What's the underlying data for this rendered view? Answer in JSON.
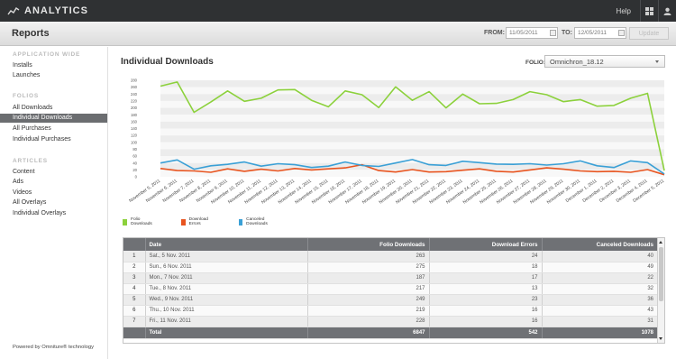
{
  "app": {
    "title": "ANALYTICS",
    "help": "Help",
    "grid_icon": "grid-icon",
    "user_icon": "user-icon",
    "logo_icon": "analytics-logo-icon"
  },
  "header": {
    "title": "Reports",
    "from_label": "FROM:",
    "from_value": "11/05/2011",
    "to_label": "TO:",
    "to_value": "12/05/2011",
    "update_label": "Update"
  },
  "sidebar": {
    "sections": [
      {
        "heading": "APPLICATION WIDE",
        "items": [
          "Installs",
          "Launches"
        ]
      },
      {
        "heading": "FOLIOS",
        "items": [
          "All Downloads",
          "Individual Downloads",
          "All Purchases",
          "Individual Purchases"
        ]
      },
      {
        "heading": "ARTICLES",
        "items": [
          "Content",
          "Ads",
          "Videos",
          "All Overlays",
          "Individual Overlays"
        ]
      }
    ],
    "active": "Individual Downloads",
    "powered_by": "Powered by Omniture® technology"
  },
  "main": {
    "title": "Individual Downloads",
    "folio_label": "FOLIO:",
    "folio_value": "Omnichron_18.12"
  },
  "chart_data": {
    "type": "line",
    "yticks": [
      "280",
      "260",
      "240",
      "220",
      "200",
      "180",
      "160",
      "140",
      "120",
      "100",
      "80",
      "60",
      "40",
      "20",
      "0"
    ],
    "ylim": [
      0,
      280
    ],
    "grid": true,
    "legend_position": "bottom-left",
    "categories": [
      "November 5, 2011",
      "November 6, 2011",
      "November 7, 2011",
      "November 8, 2011",
      "November 9, 2011",
      "November 10, 2011",
      "November 11, 2011",
      "November 12, 2011",
      "November 13, 2011",
      "November 14, 2011",
      "November 15, 2011",
      "November 16, 2011",
      "November 17, 2011",
      "November 18, 2011",
      "November 19, 2011",
      "November 20, 2011",
      "November 21, 2011",
      "November 22, 2011",
      "November 23, 2011",
      "November 24, 2011",
      "November 25, 2011",
      "November 26, 2011",
      "November 27, 2011",
      "November 28, 2011",
      "November 29, 2011",
      "November 30, 2011",
      "December 1, 2011",
      "December 2, 2011",
      "December 3, 2011",
      "December 4, 2011",
      "December 5, 2011"
    ],
    "series": [
      {
        "name": "Folio Downloads",
        "color": "#8cd13c",
        "values": [
          263,
          275,
          187,
          217,
          249,
          219,
          228,
          252,
          253,
          222,
          203,
          249,
          238,
          201,
          261,
          222,
          247,
          200,
          240,
          212,
          213,
          224,
          247,
          238,
          218,
          224,
          205,
          207,
          228,
          242,
          18
        ]
      },
      {
        "name": "Download Errors",
        "color": "#e8541f",
        "values": [
          24,
          18,
          17,
          13,
          23,
          16,
          22,
          17,
          24,
          20,
          23,
          26,
          35,
          18,
          14,
          21,
          14,
          15,
          19,
          23,
          16,
          14,
          20,
          26,
          22,
          17,
          15,
          16,
          13,
          21,
          6
        ]
      },
      {
        "name": "Canceled Downloads",
        "color": "#3aa0d6",
        "values": [
          40,
          49,
          22,
          32,
          36,
          43,
          31,
          38,
          35,
          27,
          31,
          43,
          33,
          30,
          40,
          50,
          35,
          33,
          45,
          41,
          37,
          36,
          38,
          34,
          38,
          46,
          32,
          27,
          46,
          41,
          8
        ]
      }
    ]
  },
  "table": {
    "columns": [
      "Date",
      "Folio Downloads",
      "Download Errors",
      "Canceled Downloads"
    ],
    "rows": [
      {
        "n": "1",
        "date": "Sat., 5 Nov. 2011",
        "folio": "263",
        "errors": "24",
        "canceled": "40"
      },
      {
        "n": "2",
        "date": "Sun., 6 Nov. 2011",
        "folio": "275",
        "errors": "18",
        "canceled": "49"
      },
      {
        "n": "3",
        "date": "Mon., 7 Nov. 2011",
        "folio": "187",
        "errors": "17",
        "canceled": "22"
      },
      {
        "n": "4",
        "date": "Tue., 8 Nov. 2011",
        "folio": "217",
        "errors": "13",
        "canceled": "32"
      },
      {
        "n": "5",
        "date": "Wed., 9 Nov. 2011",
        "folio": "249",
        "errors": "23",
        "canceled": "36"
      },
      {
        "n": "6",
        "date": "Thu., 10 Nov. 2011",
        "folio": "219",
        "errors": "16",
        "canceled": "43"
      },
      {
        "n": "7",
        "date": "Fri., 11 Nov. 2011",
        "folio": "228",
        "errors": "16",
        "canceled": "31"
      }
    ],
    "total": {
      "label": "Total",
      "folio": "6847",
      "errors": "542",
      "canceled": "1078"
    }
  }
}
